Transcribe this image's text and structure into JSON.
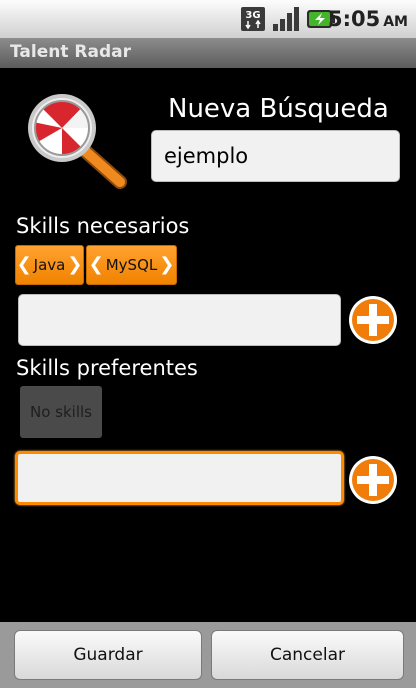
{
  "status_bar": {
    "network": "3G",
    "time": "5:05",
    "ampm": "AM",
    "icons": [
      "3g-icon",
      "signal-icon",
      "battery-charging-icon"
    ]
  },
  "app": {
    "title": "Talent Radar"
  },
  "form": {
    "heading": "Nueva Búsqueda",
    "name_value": "ejemplo",
    "required_label": "Skills necesarios",
    "required_skills": [
      "Java",
      "MySQL"
    ],
    "required_input_value": "",
    "preferred_label": "Skills preferentes",
    "preferred_empty_text": "No skills",
    "preferred_input_value": ""
  },
  "actions": {
    "save_label": "Guardar",
    "cancel_label": "Cancelar"
  },
  "colors": {
    "accent": "#f08200",
    "background": "#000000",
    "title_bar": "#707070"
  }
}
